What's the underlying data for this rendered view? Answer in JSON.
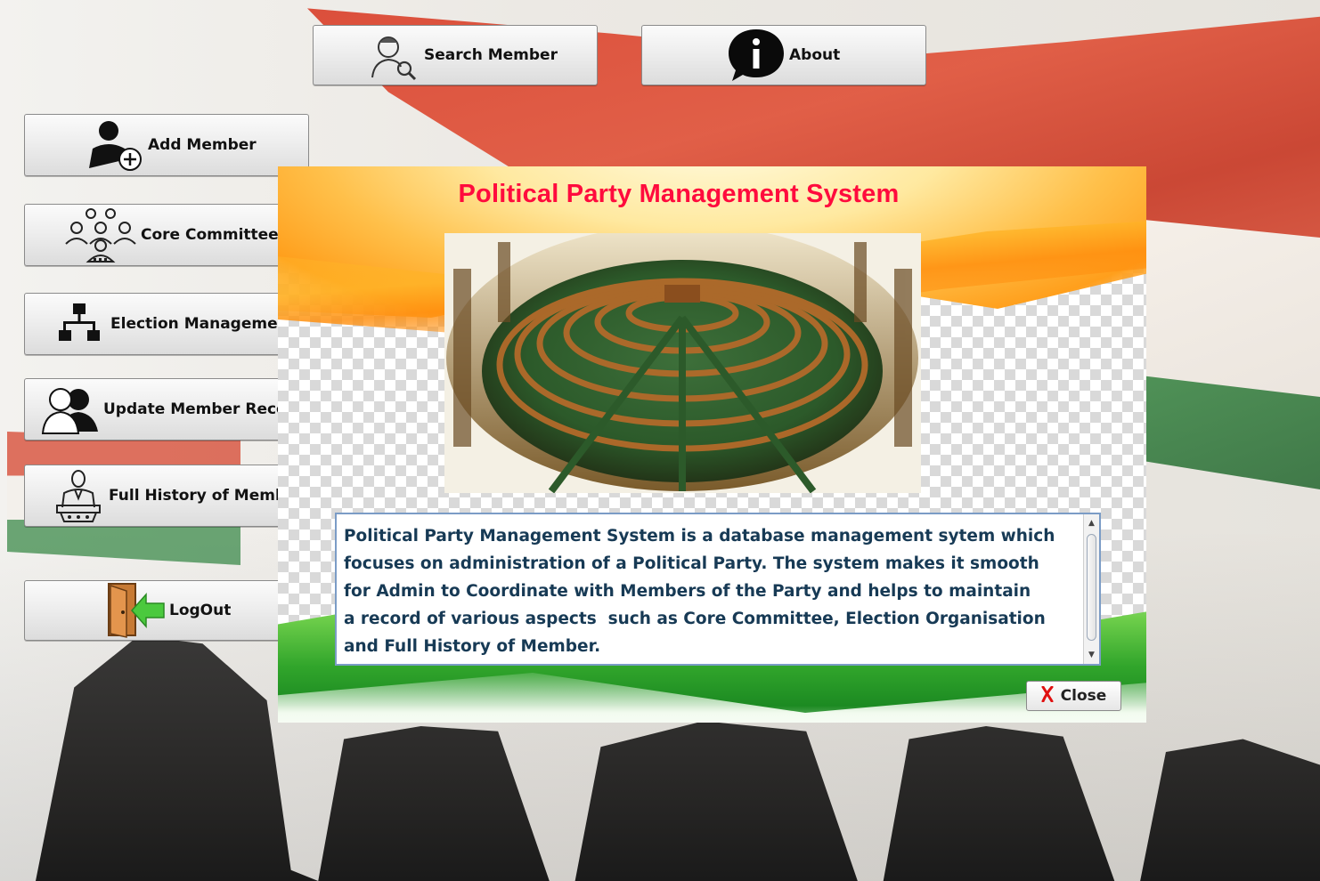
{
  "menu": {
    "search_member": "Search Member",
    "about": "About",
    "add_member": "Add Member",
    "core_committee": "Core Committee",
    "election_management": "Election Managemen",
    "update_member_record": "Update Member Recor",
    "full_history": "Full History of Membe",
    "logout": "LogOut"
  },
  "dialog": {
    "title": "Political Party Management System",
    "description": "Political Party Management System is a database management sytem which\nfocuses on administration of a Political Party. The system makes it smooth\nfor Admin to Coordinate with Members of the Party and helps to maintain\na record of various aspects  such as Core Committee, Election Organisation\nand Full History of Member.",
    "close_label": "Close"
  },
  "colors": {
    "title_red": "#ff0b3d",
    "text_blue": "#173a55",
    "close_x": "#e01010"
  }
}
